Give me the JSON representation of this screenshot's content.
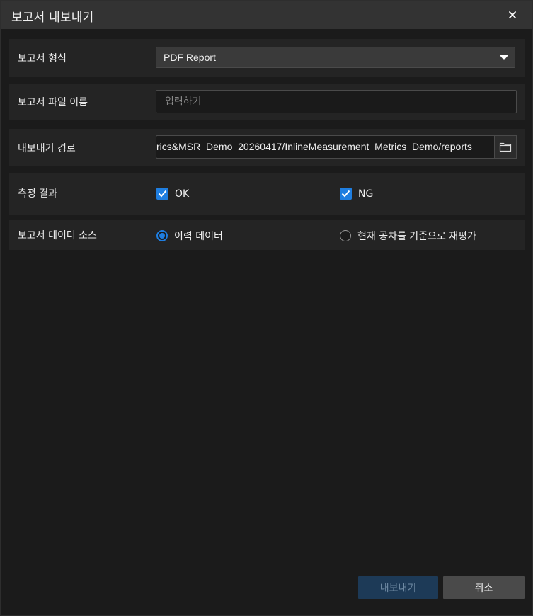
{
  "dialog": {
    "title": "보고서 내보내기",
    "close_glyph": "×"
  },
  "format_row": {
    "label": "보고서 형식",
    "selected": "PDF Report"
  },
  "filename_row": {
    "label": "보고서 파일 이름",
    "placeholder": "입력하기",
    "value": ""
  },
  "path_row": {
    "label": "내보내기 경로",
    "value": "rics&MSR_Demo_20260417/InlineMeasurement_Metrics_Demo/reports"
  },
  "result_row": {
    "label": "측정 결과",
    "options": [
      {
        "label": "OK",
        "checked": true
      },
      {
        "label": "NG",
        "checked": true
      }
    ]
  },
  "source_row": {
    "label": "보고서 데이터 소스",
    "options": [
      {
        "label": "이력 데이터",
        "selected": true
      },
      {
        "label": "현재 공차를 기준으로 재평가",
        "selected": false
      }
    ]
  },
  "footer": {
    "export_label": "내보내기",
    "cancel_label": "취소"
  },
  "colors": {
    "accent": "#1f7ee0",
    "background": "#1b1b1b",
    "row_background": "#242424",
    "titlebar": "#333333"
  }
}
